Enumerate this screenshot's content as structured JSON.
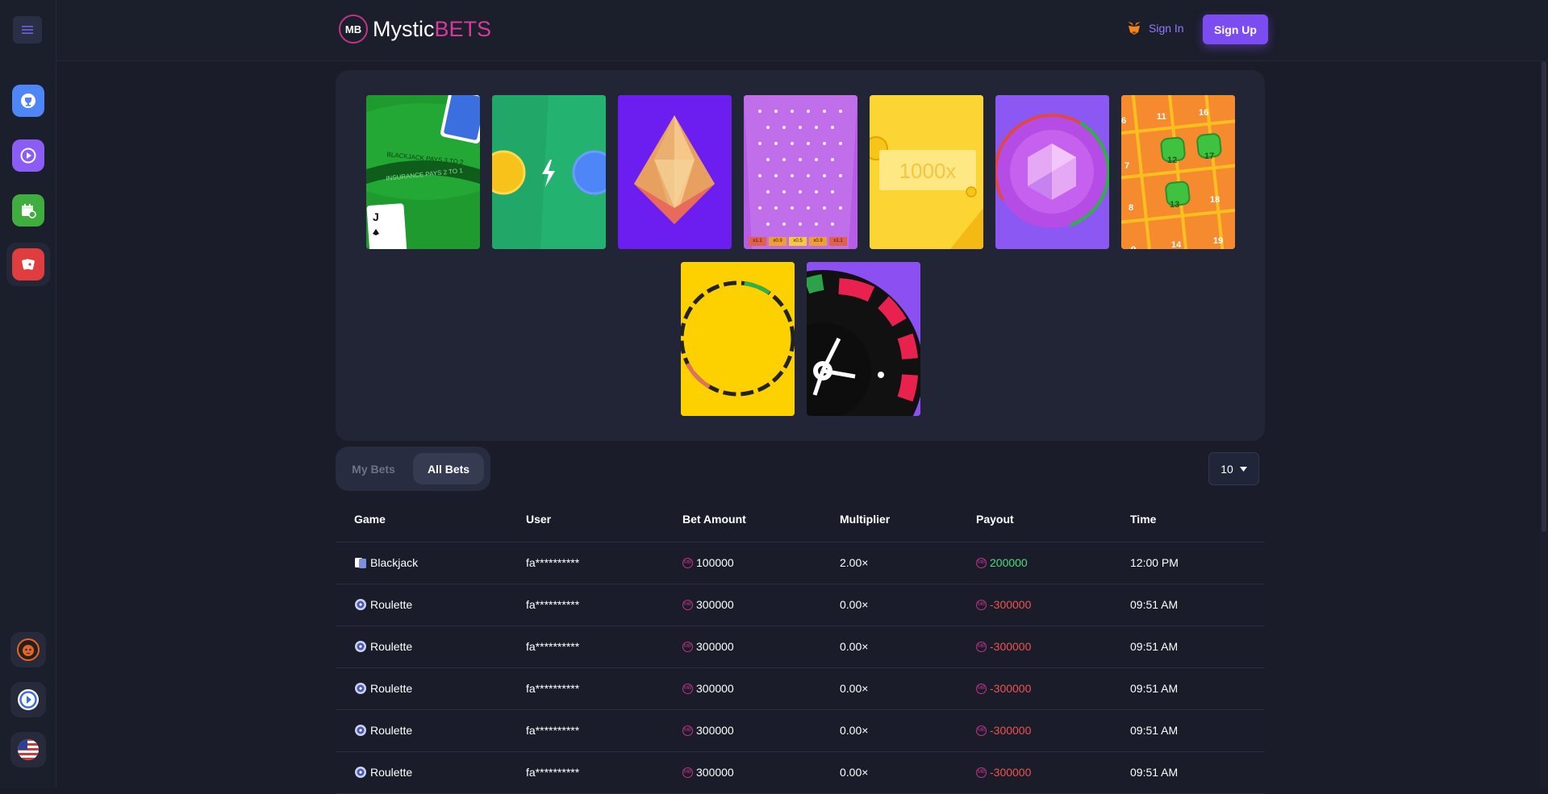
{
  "brand": {
    "logo_mark": "MB",
    "name_main": "Mystic",
    "name_accent": "BETS",
    "accent_color": "#d63a9a"
  },
  "header": {
    "signin_label": "Sign In",
    "signup_label": "Sign Up"
  },
  "sidebar": {
    "items": [
      {
        "icon": "trophy-icon",
        "color": "#4f86f7"
      },
      {
        "icon": "play-icon",
        "color": "#8b5cf6"
      },
      {
        "icon": "calendar-icon",
        "color": "#3fae3f"
      },
      {
        "icon": "cards-icon",
        "color": "#e03e3e"
      }
    ],
    "bottom": [
      {
        "icon": "tiger-icon"
      },
      {
        "icon": "support-icon"
      },
      {
        "icon": "us-flag-icon"
      }
    ]
  },
  "games": [
    {
      "name": "blackjack",
      "felt_line1": "BLACKJACK PAYS 3 TO 2",
      "felt_line2": "INSURANCE PAYS 2 TO 1",
      "card_rank": "J"
    },
    {
      "name": "coinflip"
    },
    {
      "name": "crystal"
    },
    {
      "name": "plinko",
      "slots": [
        "x1.1",
        "x0.9",
        "x0.5",
        "x0.9",
        "x1.1"
      ]
    },
    {
      "name": "crash",
      "label": "1000x"
    },
    {
      "name": "wheel"
    },
    {
      "name": "keno",
      "numbers": [
        "6",
        "11",
        "16",
        "7",
        "12",
        "17",
        "8",
        "13",
        "18",
        "9",
        "14",
        "19"
      ]
    },
    {
      "name": "limbo"
    },
    {
      "name": "roulette"
    }
  ],
  "bets": {
    "tab_mine": "My Bets",
    "tab_all": "All Bets",
    "page_size": "10",
    "columns": [
      "Game",
      "User",
      "Bet Amount",
      "Multiplier",
      "Payout",
      "Time"
    ],
    "coin_mark": "MB",
    "rows": [
      {
        "game": "Blackjack",
        "user": "fa**********",
        "amount": "100000",
        "multiplier": "2.00×",
        "payout": "200000",
        "time": "12:00 PM",
        "win": true
      },
      {
        "game": "Roulette",
        "user": "fa**********",
        "amount": "300000",
        "multiplier": "0.00×",
        "payout": "-300000",
        "time": "09:51 AM",
        "win": false
      },
      {
        "game": "Roulette",
        "user": "fa**********",
        "amount": "300000",
        "multiplier": "0.00×",
        "payout": "-300000",
        "time": "09:51 AM",
        "win": false
      },
      {
        "game": "Roulette",
        "user": "fa**********",
        "amount": "300000",
        "multiplier": "0.00×",
        "payout": "-300000",
        "time": "09:51 AM",
        "win": false
      },
      {
        "game": "Roulette",
        "user": "fa**********",
        "amount": "300000",
        "multiplier": "0.00×",
        "payout": "-300000",
        "time": "09:51 AM",
        "win": false
      },
      {
        "game": "Roulette",
        "user": "fa**********",
        "amount": "300000",
        "multiplier": "0.00×",
        "payout": "-300000",
        "time": "09:51 AM",
        "win": false
      }
    ]
  }
}
